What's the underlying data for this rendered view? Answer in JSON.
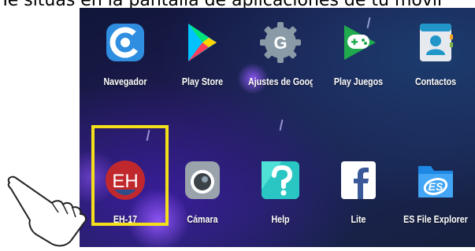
{
  "caption": "Te situas en la pantalla de aplicaciones de tu móvil",
  "apps": [
    {
      "label": "Navegador",
      "icon": "browser-icon"
    },
    {
      "label": "Play Store",
      "icon": "play-store-icon"
    },
    {
      "label": "Ajustes de Google",
      "icon": "google-settings-icon"
    },
    {
      "label": "Play Juegos",
      "icon": "play-games-icon"
    },
    {
      "label": "Contactos",
      "icon": "contacts-icon"
    },
    {
      "label": "EH-17",
      "icon": "eh17-app-icon"
    },
    {
      "label": "Cámara",
      "icon": "camera-icon"
    },
    {
      "label": "Help",
      "icon": "help-icon"
    },
    {
      "label": "Lite",
      "icon": "facebook-lite-icon"
    },
    {
      "label": "ES File Explorer",
      "icon": "es-file-explorer-icon"
    }
  ],
  "eh17_icon_text": "EH",
  "highlight_color": "#f4e01a",
  "pointer_icon": "pointing-hand-icon"
}
